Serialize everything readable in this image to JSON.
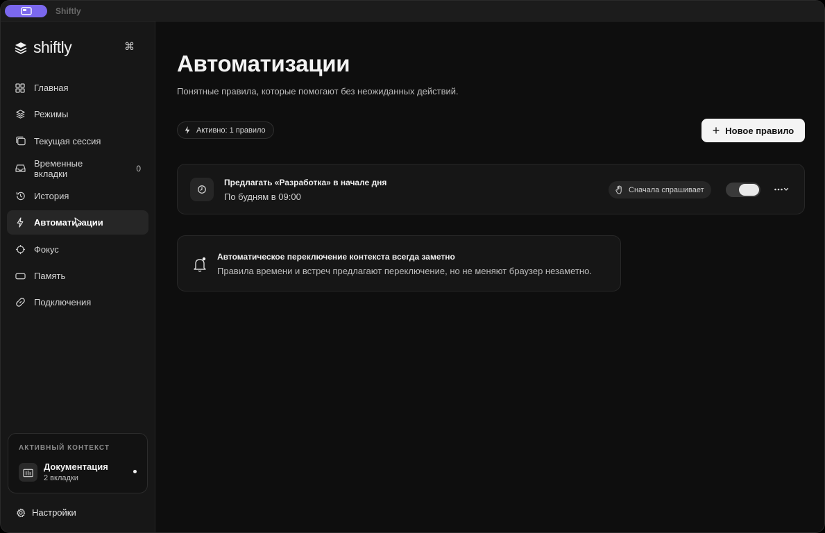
{
  "window": {
    "title": "Shiftly"
  },
  "brand": {
    "name": "shiftly",
    "shortcut": "⌘"
  },
  "nav": [
    {
      "label": "Главная",
      "icon": "grid-icon"
    },
    {
      "label": "Режимы",
      "icon": "layers-icon"
    },
    {
      "label": "Текущая сессия",
      "icon": "windows-icon"
    },
    {
      "label": "Временные вкладки",
      "icon": "inbox-icon",
      "count": "0"
    },
    {
      "label": "История",
      "icon": "history-icon"
    },
    {
      "label": "Автоматизации",
      "icon": "lightning-icon",
      "active": true
    },
    {
      "label": "Фокус",
      "icon": "target-icon"
    },
    {
      "label": "Память",
      "icon": "memory-icon"
    },
    {
      "label": "Подключения",
      "icon": "link-icon"
    }
  ],
  "context": {
    "header": "АКТИВНЫЙ КОНТЕКСТ",
    "title": "Документация",
    "subtitle": "2 вкладки"
  },
  "settings": {
    "label": "Настройки"
  },
  "page": {
    "title": "Автоматизации",
    "subtitle": "Понятные правила, которые помогают без неожиданных действий.",
    "active_count": "Активно: 1 правило",
    "new_rule": "Новое правило"
  },
  "rule": {
    "title": "Предлагать «Разработка» в начале дня",
    "schedule": "По будням в 09:00",
    "mode": "Сначала спрашивает",
    "enabled": true
  },
  "notice": {
    "title": "Автоматическое переключение контекста всегда заметно",
    "text": "Правила времени и встреч предлагают переключение, но не меняют браузер незаметно."
  },
  "colors": {
    "accent": "#7b68ee",
    "background": "#0e0e0e",
    "sidebar": "#171717"
  }
}
